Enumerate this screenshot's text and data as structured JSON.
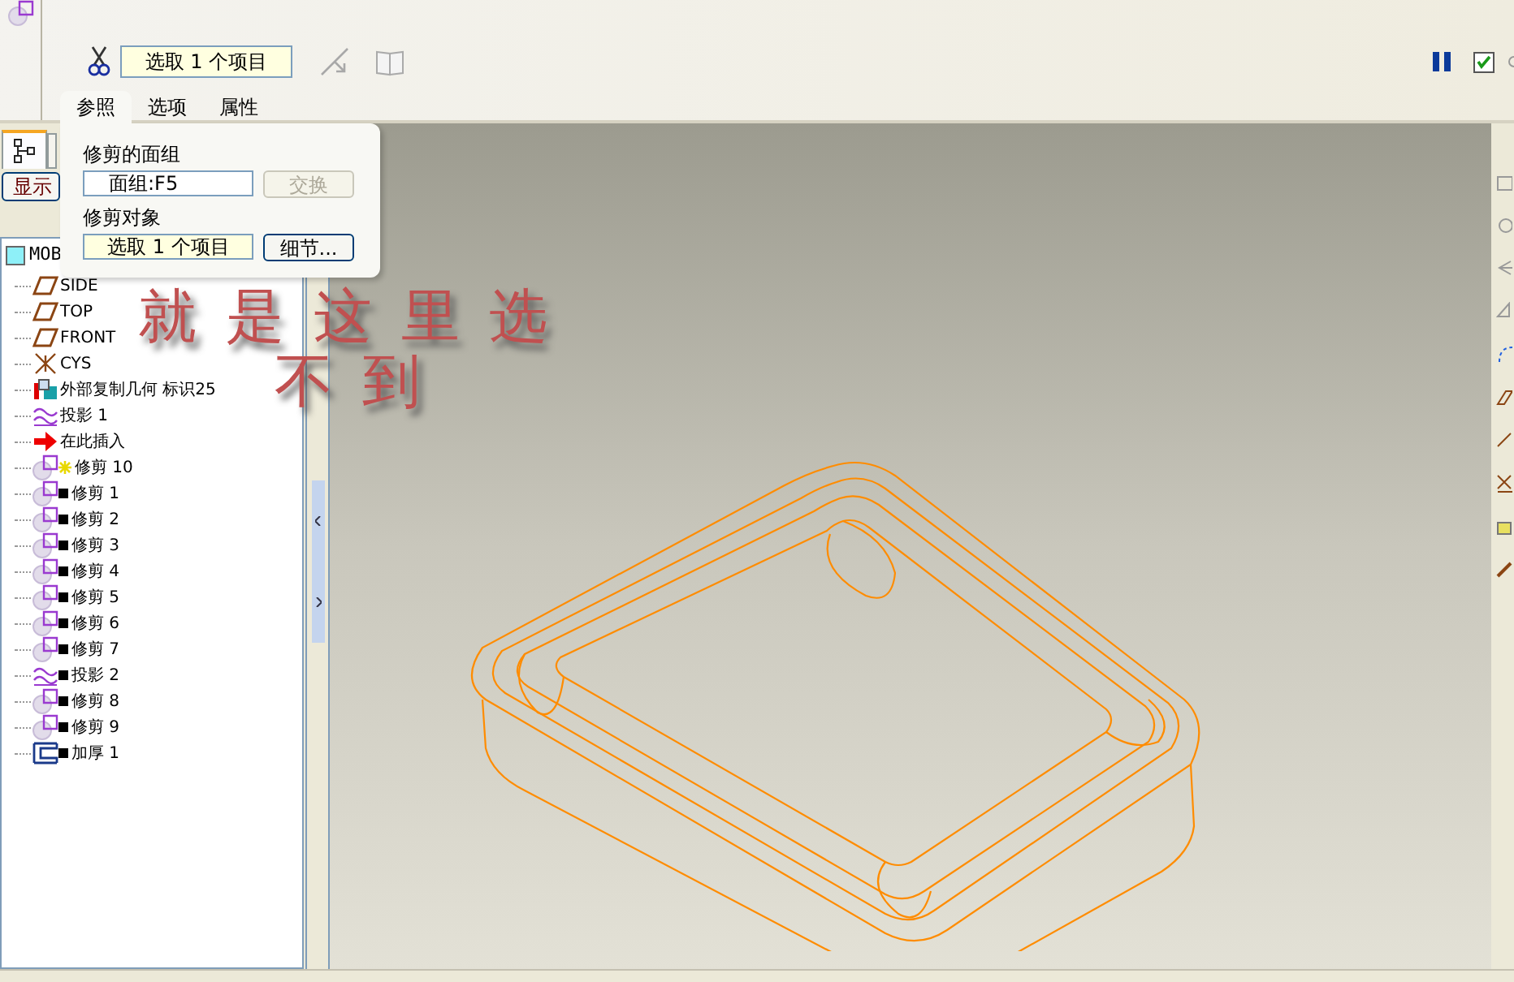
{
  "dashboard": {
    "collector": "选取 1 个项目",
    "paused": true,
    "checked": true
  },
  "popup": {
    "tabs": [
      {
        "label": "参照",
        "selected": true
      },
      {
        "label": "选项",
        "selected": false
      },
      {
        "label": "属性",
        "selected": false
      }
    ],
    "quilt_label": "修剪的面组",
    "quilt_value": "面组:F5",
    "quilt_active": false,
    "swap_button": {
      "label": "交换",
      "disabled": true
    },
    "object_label": "修剪对象",
    "object_value": "选取 1 个项目",
    "object_active": true,
    "details_button": {
      "label": "细节...",
      "disabled": false
    }
  },
  "model_tree": {
    "show_button": "显示",
    "root": "MOB",
    "items": [
      {
        "kind": "plane",
        "starred": false,
        "flagged": false,
        "label": "SIDE"
      },
      {
        "kind": "plane",
        "starred": false,
        "flagged": false,
        "label": "TOP"
      },
      {
        "kind": "plane",
        "starred": false,
        "flagged": false,
        "label": "FRONT"
      },
      {
        "kind": "csys",
        "starred": false,
        "flagged": false,
        "label": "CYS"
      },
      {
        "kind": "copy",
        "starred": false,
        "flagged": false,
        "label": "外部复制几何 标识25"
      },
      {
        "kind": "projection",
        "starred": false,
        "flagged": false,
        "label": "投影 1"
      },
      {
        "kind": "insert",
        "starred": false,
        "flagged": false,
        "label": "在此插入"
      },
      {
        "kind": "trim",
        "starred": true,
        "flagged": false,
        "label": "修剪 10"
      },
      {
        "kind": "trim",
        "starred": false,
        "flagged": true,
        "label": "修剪 1"
      },
      {
        "kind": "trim",
        "starred": false,
        "flagged": true,
        "label": "修剪 2"
      },
      {
        "kind": "trim",
        "starred": false,
        "flagged": true,
        "label": "修剪 3"
      },
      {
        "kind": "trim",
        "starred": false,
        "flagged": true,
        "label": "修剪 4"
      },
      {
        "kind": "trim",
        "starred": false,
        "flagged": true,
        "label": "修剪 5"
      },
      {
        "kind": "trim",
        "starred": false,
        "flagged": true,
        "label": "修剪 6"
      },
      {
        "kind": "trim",
        "starred": false,
        "flagged": true,
        "label": "修剪 7"
      },
      {
        "kind": "projection",
        "starred": false,
        "flagged": true,
        "label": "投影 2"
      },
      {
        "kind": "trim",
        "starred": false,
        "flagged": true,
        "label": "修剪 8"
      },
      {
        "kind": "trim",
        "starred": false,
        "flagged": true,
        "label": "修剪 9"
      },
      {
        "kind": "thicken",
        "starred": false,
        "flagged": true,
        "label": "加厚 1"
      }
    ]
  },
  "annotation": [
    "就是这里选",
    "不到"
  ]
}
